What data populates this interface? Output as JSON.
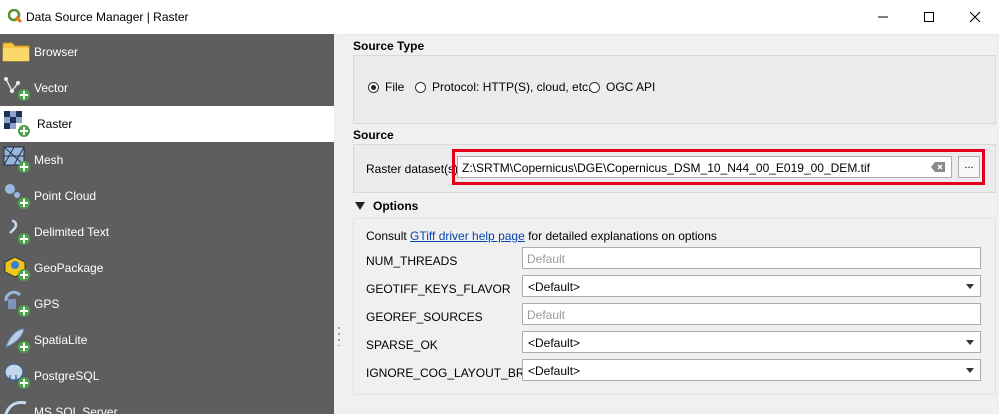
{
  "window": {
    "title": "Data Source Manager | Raster",
    "icon": "qgis-logo-icon",
    "controls": [
      "minimize",
      "maximize",
      "close"
    ]
  },
  "sidebar": {
    "items": [
      {
        "label": "Browser",
        "icon": "folder-icon"
      },
      {
        "label": "Vector",
        "icon": "vector-icon"
      },
      {
        "label": "Raster",
        "icon": "raster-icon",
        "active": true
      },
      {
        "label": "Mesh",
        "icon": "mesh-icon"
      },
      {
        "label": "Point Cloud",
        "icon": "point-cloud-icon"
      },
      {
        "label": "Delimited Text",
        "icon": "delimited-text-icon"
      },
      {
        "label": "GeoPackage",
        "icon": "geopackage-icon"
      },
      {
        "label": "GPS",
        "icon": "gps-icon"
      },
      {
        "label": "SpatiaLite",
        "icon": "spatialite-icon"
      },
      {
        "label": "PostgreSQL",
        "icon": "postgresql-icon"
      },
      {
        "label": "MS SQL Server",
        "icon": "mssql-icon"
      }
    ]
  },
  "source_type": {
    "title": "Source Type",
    "options": [
      {
        "label": "File",
        "checked": true
      },
      {
        "label": "Protocol: HTTP(S), cloud, etc.",
        "checked": false
      },
      {
        "label": "OGC API",
        "checked": false
      }
    ]
  },
  "source": {
    "title": "Source",
    "dataset_label": "Raster dataset(s)",
    "dataset_value": "Z:\\SRTM\\Copernicus\\DGE\\Copernicus_DSM_10_N44_00_E019_00_DEM.tif",
    "browse_label": "...",
    "highlight_color": "#e2001a"
  },
  "options": {
    "title": "Options",
    "help_prefix": "Consult ",
    "help_link": "GTiff driver help page",
    "help_suffix": " for detailed explanations on options",
    "rows": [
      {
        "name": "NUM_THREADS",
        "kind": "text",
        "placeholder": "Default"
      },
      {
        "name": "GEOTIFF_KEYS_FLAVOR",
        "kind": "combo",
        "value": "<Default>"
      },
      {
        "name": "GEOREF_SOURCES",
        "kind": "text",
        "placeholder": "Default"
      },
      {
        "name": "SPARSE_OK",
        "kind": "combo",
        "value": "<Default>"
      },
      {
        "name": "IGNORE_COG_LAYOUT_BREAK",
        "kind": "combo",
        "value": "<Default>"
      }
    ]
  }
}
